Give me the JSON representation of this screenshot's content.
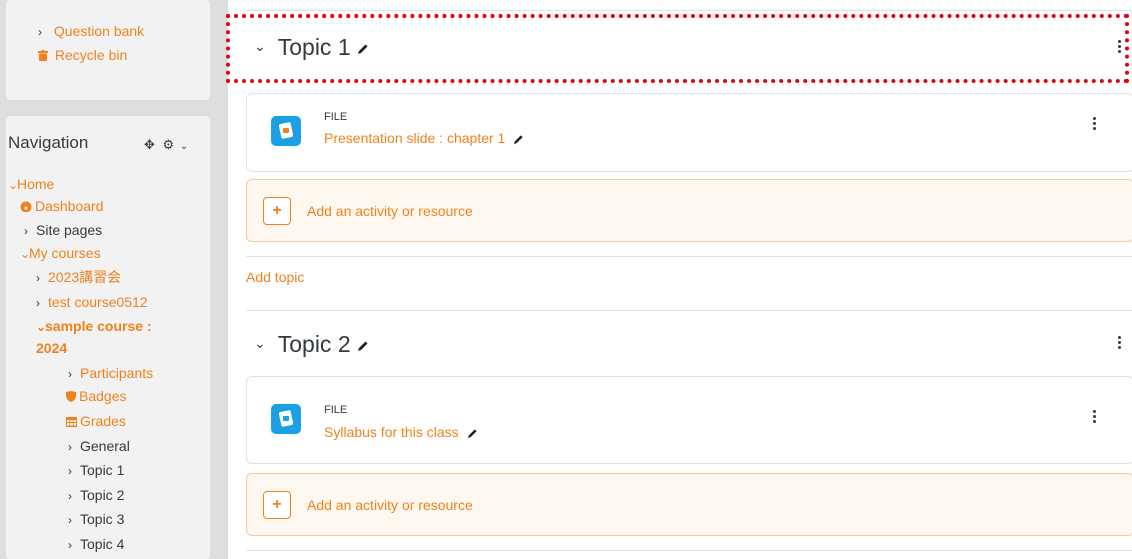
{
  "sidebar_top": {
    "items": [
      {
        "label": "Question bank",
        "chevron": "›",
        "icon": "none"
      },
      {
        "label": "Recycle bin",
        "icon": "trash-icon"
      }
    ]
  },
  "navigation": {
    "title": "Navigation",
    "home": "Home",
    "dashboard": "Dashboard",
    "site_pages": "Site pages",
    "my_courses": "My courses",
    "course_2023": "2023講習会",
    "course_test": "test course0512",
    "course_sample_line1": "sample course :",
    "course_sample_line2": "2024",
    "participants": "Participants",
    "badges": "Badges",
    "grades": "Grades",
    "general": "General",
    "topic1": "Topic 1",
    "topic2": "Topic 2",
    "topic3": "Topic 3",
    "topic4": "Topic 4"
  },
  "main": {
    "topic1_title": "Topic 1",
    "topic1_activity": {
      "type": "FILE",
      "name": "Presentation slide : chapter 1"
    },
    "add_activity_label": "Add an activity or resource",
    "add_topic": "Add topic",
    "topic2_title": "Topic 2",
    "topic2_activity": {
      "type": "FILE",
      "name": "Syllabus for this class"
    }
  },
  "colors": {
    "accent": "#f0821e",
    "highlight": "#e4000f",
    "file_icon": "#1aa0e3"
  }
}
